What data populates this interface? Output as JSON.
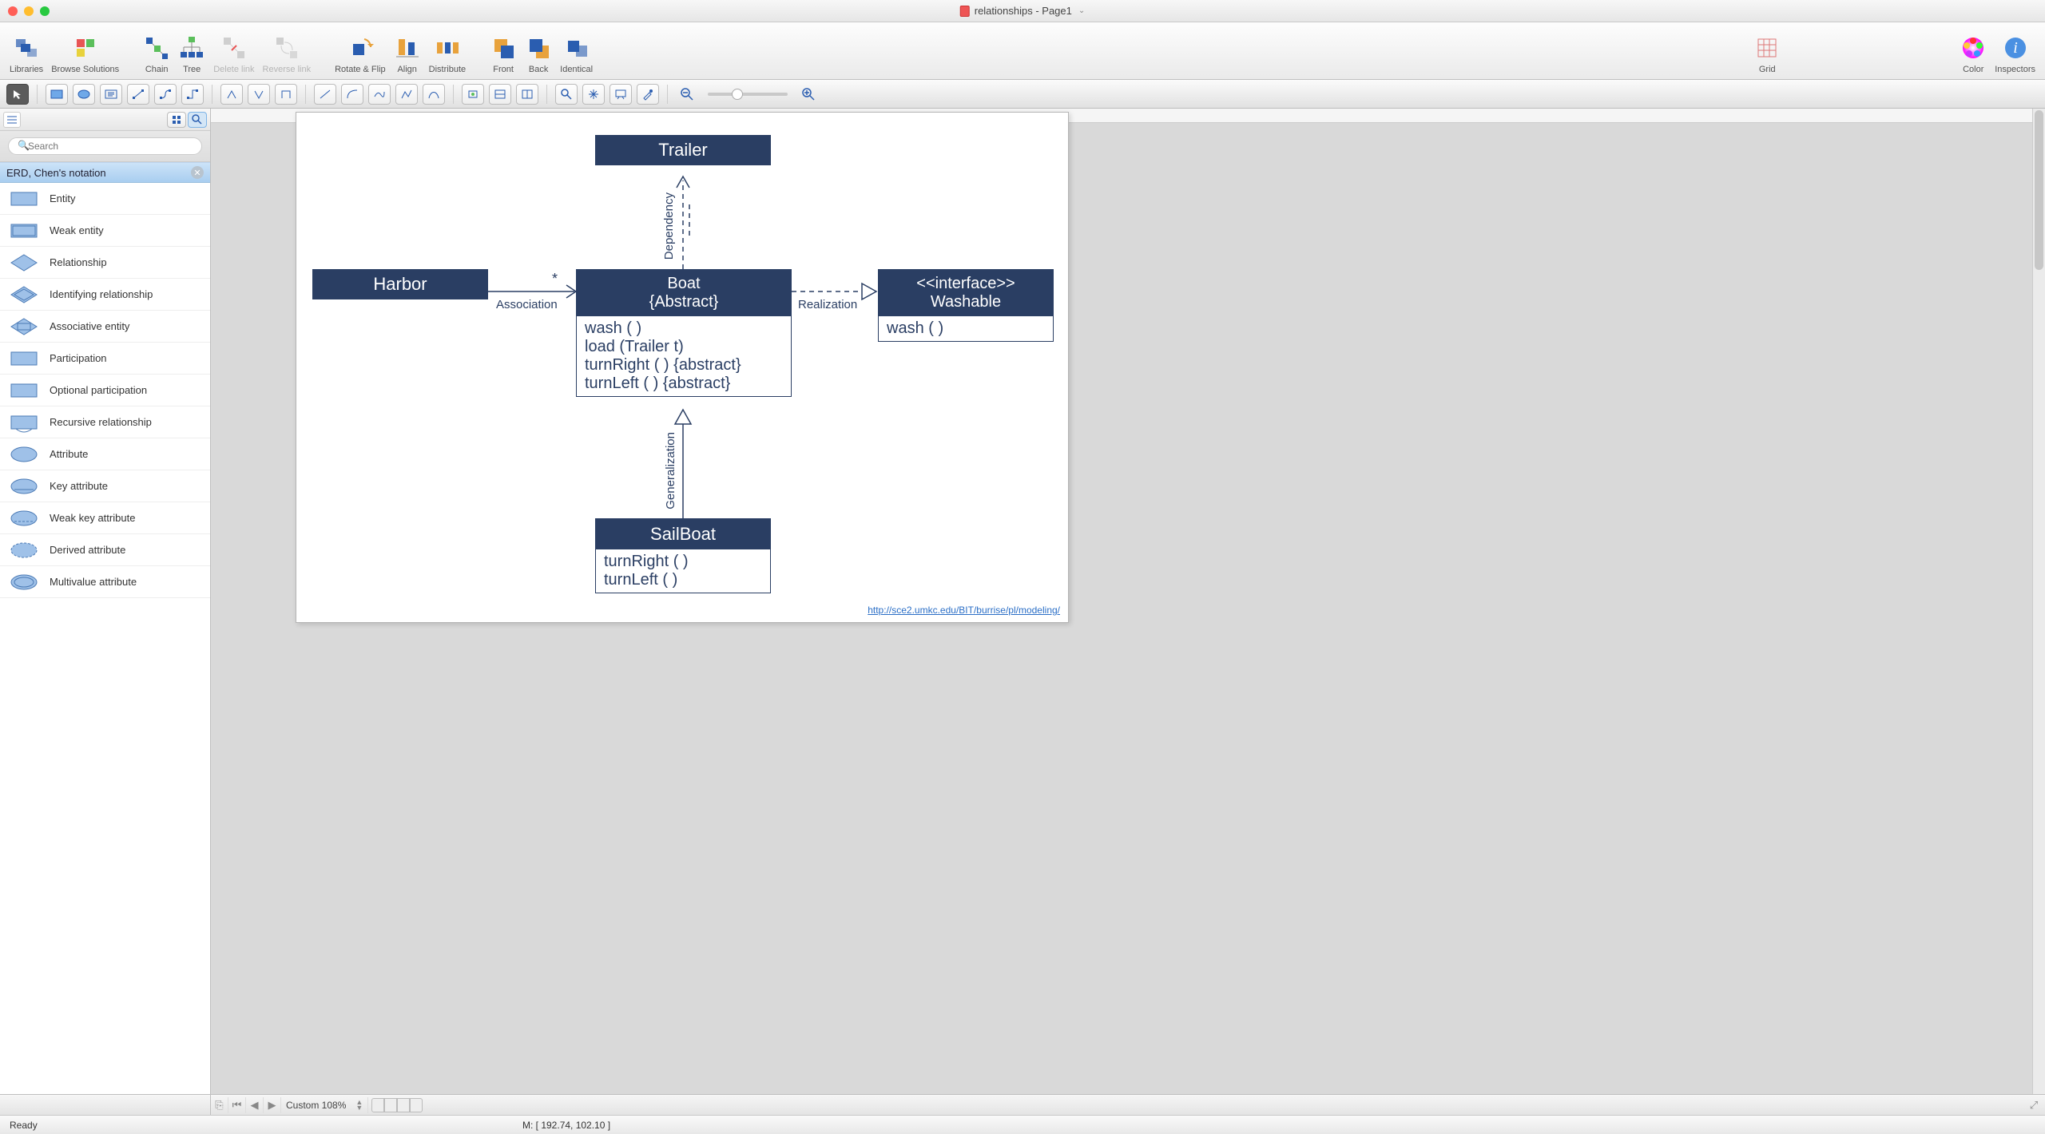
{
  "window": {
    "title": "relationships - Page1"
  },
  "toolbar": {
    "groups": [
      [
        {
          "label": "Libraries",
          "icon": "libraries"
        },
        {
          "label": "Browse Solutions",
          "icon": "solutions"
        }
      ],
      [
        {
          "label": "Chain",
          "icon": "chain"
        },
        {
          "label": "Tree",
          "icon": "tree"
        },
        {
          "label": "Delete link",
          "icon": "delete-link",
          "disabled": true
        },
        {
          "label": "Reverse link",
          "icon": "reverse-link",
          "disabled": true
        }
      ],
      [
        {
          "label": "Rotate & Flip",
          "icon": "rotate"
        },
        {
          "label": "Align",
          "icon": "align"
        },
        {
          "label": "Distribute",
          "icon": "distribute"
        }
      ],
      [
        {
          "label": "Front",
          "icon": "front"
        },
        {
          "label": "Back",
          "icon": "back"
        },
        {
          "label": "Identical",
          "icon": "identical"
        }
      ],
      [
        {
          "label": "Grid",
          "icon": "grid"
        }
      ],
      [
        {
          "label": "Color",
          "icon": "color"
        },
        {
          "label": "Inspectors",
          "icon": "inspectors"
        }
      ]
    ]
  },
  "sidebar": {
    "search_placeholder": "Search",
    "category": "ERD, Chen's notation",
    "shapes": [
      "Entity",
      "Weak entity",
      "Relationship",
      "Identifying relationship",
      "Associative entity",
      "Participation",
      "Optional participation",
      "Recursive relationship",
      "Attribute",
      "Key attribute",
      "Weak key attribute",
      "Derived attribute",
      "Multivalue attribute"
    ]
  },
  "diagram": {
    "trailer": {
      "title": "Trailer"
    },
    "harbor": {
      "title": "Harbor"
    },
    "boat": {
      "title": "Boat",
      "subtitle": "{Abstract}",
      "ops": [
        "wash ( )",
        "load (Trailer t)",
        "turnRight ( ) {abstract}",
        "turnLeft ( ) {abstract}"
      ]
    },
    "washable": {
      "stereo": "<<interface>>",
      "title": "Washable",
      "ops": [
        "wash ( )"
      ]
    },
    "sailboat": {
      "title": "SailBoat",
      "ops": [
        "turnRight ( )",
        "turnLeft ( )"
      ]
    },
    "labels": {
      "dependency": "Dependency",
      "association": "Association",
      "multiplicity": "*",
      "realization": "Realization",
      "generalization": "Generalization"
    },
    "citation": "http://sce2.umkc.edu/BIT/burrise/pl/modeling/"
  },
  "pagebar": {
    "zoom": "Custom 108%"
  },
  "status": {
    "ready": "Ready",
    "mouse": "M: [ 192.74, 102.10 ]"
  }
}
